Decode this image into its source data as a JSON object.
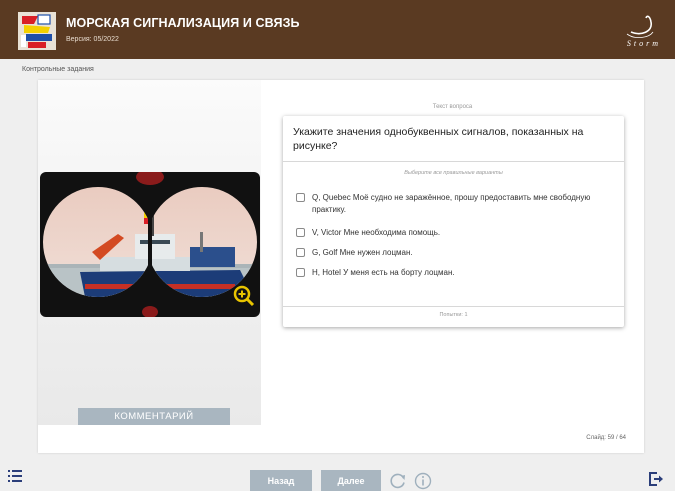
{
  "header": {
    "title": "МОРСКАЯ СИГНАЛИЗАЦИЯ И СВЯЗЬ",
    "version": "Версия: 05/2022",
    "brand": "Storm",
    "logo_icon": "signal-flags-logo-icon",
    "background_color": "#5a3a22"
  },
  "section_label": "Контрольные задания",
  "left_panel": {
    "image_icon": "binocular-ship-view",
    "zoom_icon": "zoom-in-icon",
    "comment_label": "КОММЕНТАРИЙ"
  },
  "question": {
    "label": "Текст вопроса",
    "text": "Укажите значения однобуквенных сигналов, показанных на рисунке?",
    "instruction": "Выберите все правильные варианты",
    "options": [
      {
        "label": "Q, Quebec Моё судно не заражённое, прошу предоставить мне свободную практику.",
        "checked": false
      },
      {
        "label": "V, Victor Мне необходима помощь.",
        "checked": false
      },
      {
        "label": "G, Golf Мне нужен лоцман.",
        "checked": false
      },
      {
        "label": "H, Hotel У меня есть на борту лоцман.",
        "checked": false
      }
    ],
    "attempts": "Попытки: 1"
  },
  "slide_counter": "Слайд: 59 / 64",
  "footer": {
    "back_label": "Назад",
    "next_label": "Далее",
    "button_color": "#a9b6c0"
  }
}
